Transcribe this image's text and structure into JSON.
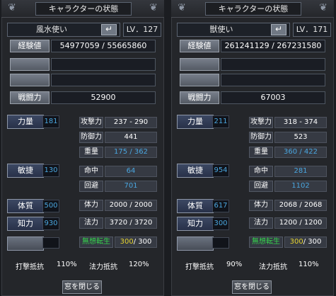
{
  "window": {
    "title": "キャラクターの状態",
    "close_label": "窓を閉じる"
  },
  "left": {
    "name": "風水使い",
    "level": "LV．127",
    "exp_label": "経験値",
    "exp_value": "54977059 / 55665860",
    "power_label": "戦闘力",
    "power_value": "52900",
    "str_label": "力量",
    "str_value": "181",
    "dex_label": "敏捷",
    "dex_value": "130",
    "con_label": "体質",
    "con_value": "500",
    "int_label": "知力",
    "int_value": "930",
    "atk_label": "攻撃力",
    "atk_value": "237 - 290",
    "def_label": "防御力",
    "def_value": "441",
    "weight_label": "重量",
    "weight_value": "175 / 362",
    "hit_label": "命中",
    "hit_value": "64",
    "eva_label": "回避",
    "eva_value": "701",
    "hp_label": "体力",
    "hp_value": "2000 / 2000",
    "mp_label": "法力",
    "mp_value": "3720 / 3720",
    "rebirth_label": "無想転生",
    "rebirth_current": "300",
    "rebirth_max": "/ 300",
    "hit_resist_label": "打撃抵抗",
    "hit_resist_value": "110%",
    "magic_resist_label": "法力抵抗",
    "magic_resist_value": "120%"
  },
  "right": {
    "name": "獣使い",
    "level": "LV．171",
    "exp_label": "経験値",
    "exp_value": "261241129 / 267231580",
    "power_label": "戦闘力",
    "power_value": "67003",
    "str_label": "力量",
    "str_value": "211",
    "dex_label": "敏捷",
    "dex_value": "954",
    "con_label": "体質",
    "con_value": "617",
    "int_label": "知力",
    "int_value": "300",
    "atk_label": "攻撃力",
    "atk_value": "318 - 374",
    "def_label": "防御力",
    "def_value": "523",
    "weight_label": "重量",
    "weight_value": "360 / 422",
    "hit_label": "命中",
    "hit_value": "281",
    "eva_label": "回避",
    "eva_value": "1102",
    "hp_label": "体力",
    "hp_value": "2068 / 2068",
    "mp_label": "法力",
    "mp_value": "1200 / 1200",
    "rebirth_label": "無想転生",
    "rebirth_current": "300",
    "rebirth_max": "/ 300",
    "hit_resist_label": "打撃抵抗",
    "hit_resist_value": "90%",
    "magic_resist_label": "法力抵抗",
    "magic_resist_value": "110%"
  },
  "icons": {
    "corner": "corner-ornament-icon",
    "back": "return-arrow-icon"
  },
  "colors": {
    "stat_value": "#4aa6df",
    "rebirth_label": "#36d44e",
    "rebirth_value": "#e6d42f"
  }
}
